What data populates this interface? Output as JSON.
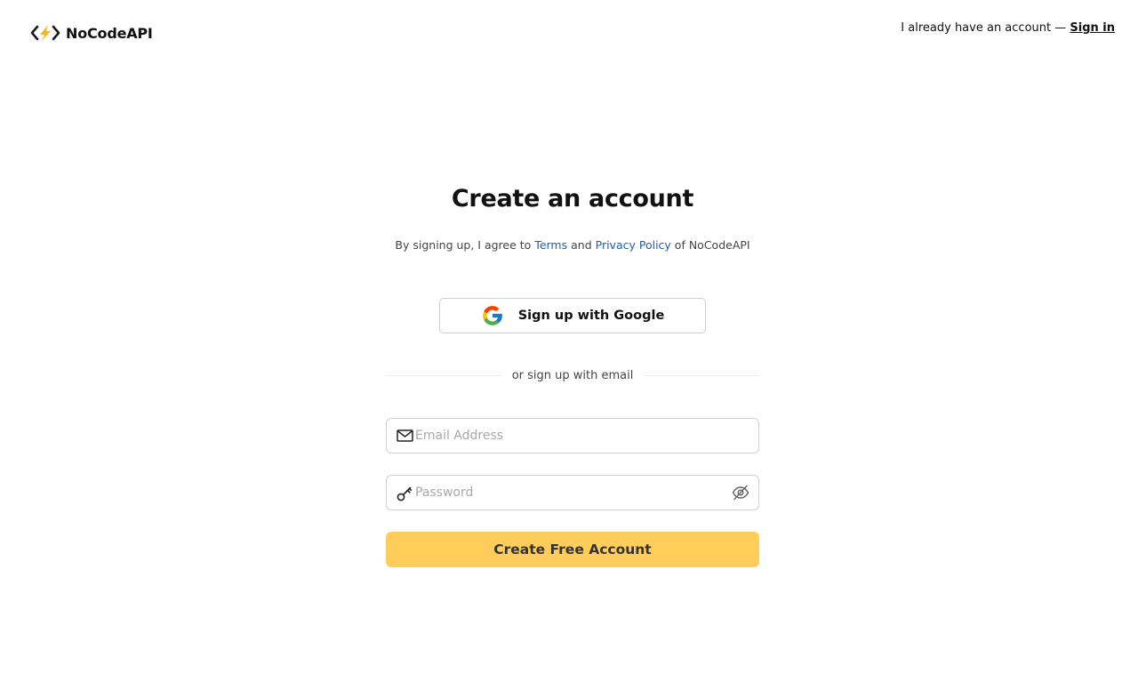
{
  "brand": {
    "name": "NoCodeAPI",
    "logo_icon": "code-bolt-icon",
    "bolt_color": "#f5b820"
  },
  "header": {
    "prompt_text": "I already have an account —",
    "signin_label": "Sign in"
  },
  "form": {
    "title": "Create an account",
    "agree_prefix": "By signing up, I agree to",
    "terms_label": "Terms",
    "and_text": "and",
    "privacy_label": "Privacy Policy",
    "agree_suffix": "of NoCodeAPI",
    "google_button_label": "Sign up with Google",
    "divider_text": "or sign up with email",
    "email_placeholder": "Email Address",
    "password_placeholder": "Password",
    "submit_label": "Create Free Account"
  },
  "colors": {
    "link": "#1a5fb4",
    "primary_button": "#fecd5a"
  },
  "icons": {
    "email": "mail-icon",
    "password": "key-icon",
    "visibility": "eye-off-icon",
    "google": "google-icon"
  }
}
